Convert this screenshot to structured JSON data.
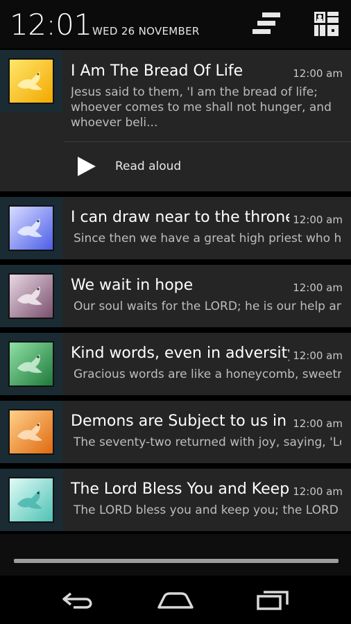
{
  "status": {
    "time": "12:01",
    "date": "WED 26 NOVEMBER",
    "clear_icon": "clear-all-icon",
    "settings_icon": "quick-settings-icon"
  },
  "notifications": [
    {
      "title": "I Am The Bread Of Life",
      "time": "12:00 am",
      "body": "Jesus said to them, 'I am the bread of life; whoever comes to me shall not hunger, and whoever beli...",
      "thumb_color": "#f5c518",
      "action_label": "Read aloud"
    },
    {
      "title": "I can draw near to the throne",
      "time": "12:00 am",
      "body": "Since then we have a great high priest who has",
      "thumb_color": "#6c7df0"
    },
    {
      "title": "We wait in hope",
      "time": "12:00 am",
      "body": "Our soul waits for the LORD; he is our help and",
      "thumb_color": "#9b6e8e"
    },
    {
      "title": "Kind words, even in adversity",
      "time": "12:00 am",
      "body": "Gracious words are like a honeycomb, sweetness",
      "thumb_color": "#33a24f"
    },
    {
      "title": "Demons are Subject to us in",
      "time": "12:00 am",
      "body": "The seventy-two returned with joy, saying, 'Lord",
      "thumb_color": "#f08a1e"
    },
    {
      "title": "The Lord Bless You and Keep",
      "time": "12:00 am",
      "body": "The LORD bless you and keep you;   the LORD",
      "thumb_color": "#6fd3c8"
    }
  ],
  "navbar": {
    "back_icon": "back-icon",
    "home_icon": "home-icon",
    "recents_icon": "recents-icon"
  }
}
